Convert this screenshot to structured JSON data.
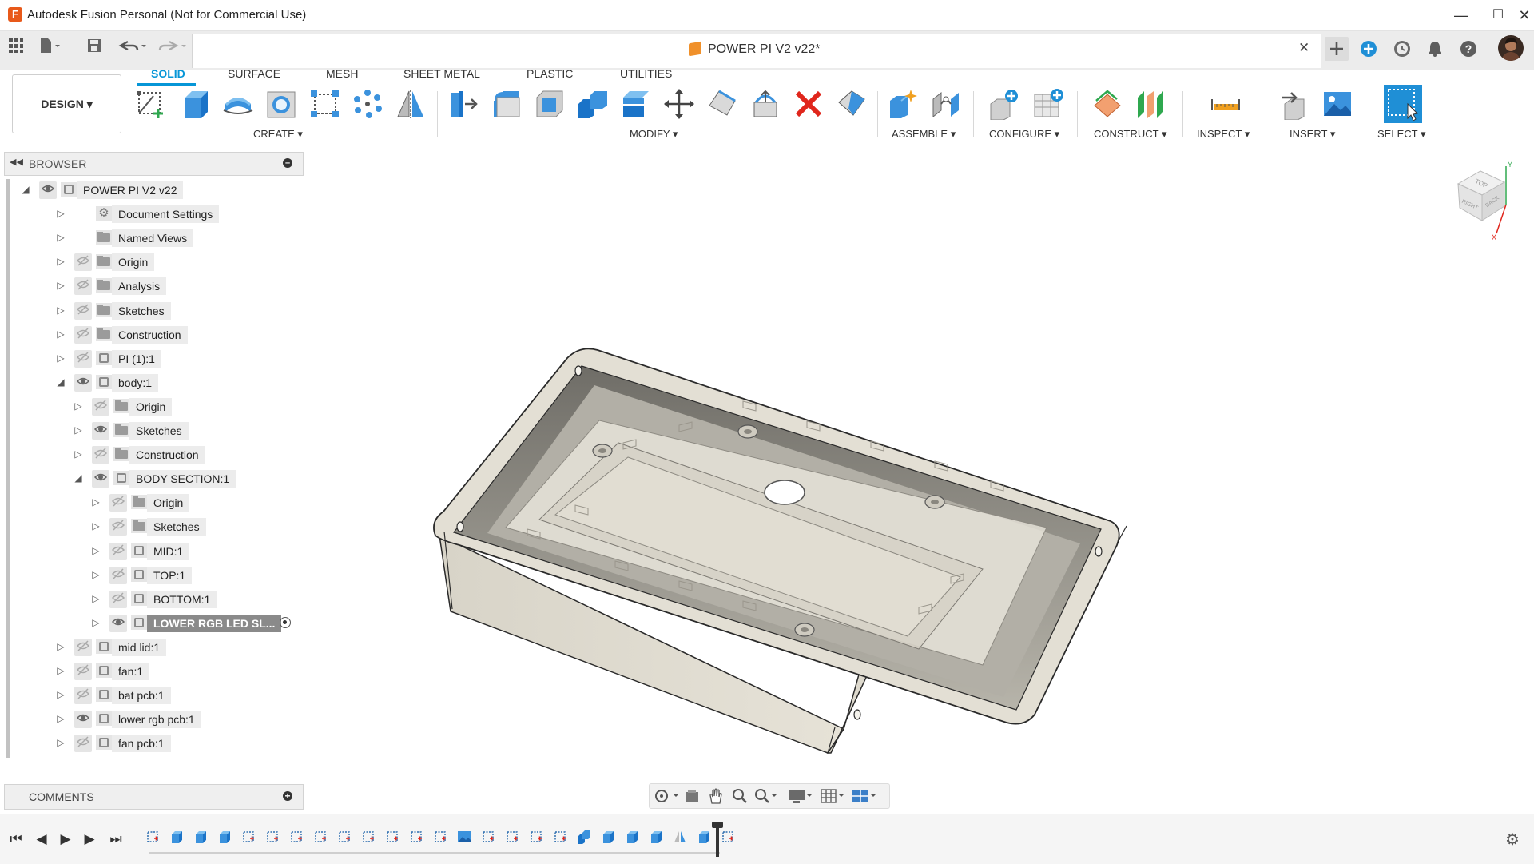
{
  "window": {
    "title": "Autodesk Fusion Personal (Not for Commercial Use)",
    "app_icon_letter": "F",
    "min_glyph": "—",
    "max_glyph": "☐",
    "close_glyph": "✕"
  },
  "document": {
    "tab_title": "POWER PI V2 v22*",
    "close_glyph": "✕"
  },
  "workspace": {
    "label": "DESIGN ▾"
  },
  "ribbon": {
    "tabs": [
      "SOLID",
      "SURFACE",
      "MESH",
      "SHEET METAL",
      "PLASTIC",
      "UTILITIES"
    ],
    "active_tab": "SOLID",
    "groups": [
      "CREATE ▾",
      "MODIFY ▾",
      "ASSEMBLE ▾",
      "CONFIGURE ▾",
      "CONSTRUCT ▾",
      "INSPECT ▾",
      "INSERT ▾",
      "SELECT ▾"
    ]
  },
  "browser": {
    "title": "BROWSER",
    "collapse_glyph": "◀◀",
    "minus_glyph": "–",
    "items": [
      {
        "label": "POWER PI V2 v22",
        "level": 0,
        "expander": "◢",
        "eye": "visible",
        "icon": "comp"
      },
      {
        "label": "Document Settings",
        "level": 1,
        "expander": "▷",
        "eye": "none",
        "icon": "gear"
      },
      {
        "label": "Named Views",
        "level": 1,
        "expander": "▷",
        "eye": "none",
        "icon": "folder"
      },
      {
        "label": "Origin",
        "level": 1,
        "expander": "▷",
        "eye": "hidden",
        "icon": "folder"
      },
      {
        "label": "Analysis",
        "level": 1,
        "expander": "▷",
        "eye": "hidden",
        "icon": "folder"
      },
      {
        "label": "Sketches",
        "level": 1,
        "expander": "▷",
        "eye": "hidden",
        "icon": "folder"
      },
      {
        "label": "Construction",
        "level": 1,
        "expander": "▷",
        "eye": "hidden",
        "icon": "folder"
      },
      {
        "label": "PI (1):1",
        "level": 1,
        "expander": "▷",
        "eye": "hidden",
        "icon": "comp"
      },
      {
        "label": "body:1",
        "level": 1,
        "expander": "◢",
        "eye": "visible",
        "icon": "comp"
      },
      {
        "label": "Origin",
        "level": 2,
        "expander": "▷",
        "eye": "hidden",
        "icon": "folder"
      },
      {
        "label": "Sketches",
        "level": 2,
        "expander": "▷",
        "eye": "visible",
        "icon": "folder"
      },
      {
        "label": "Construction",
        "level": 2,
        "expander": "▷",
        "eye": "hidden",
        "icon": "folder"
      },
      {
        "label": "BODY SECTION:1",
        "level": 2,
        "expander": "◢",
        "eye": "visible",
        "icon": "comp"
      },
      {
        "label": "Origin",
        "level": 3,
        "expander": "▷",
        "eye": "hidden",
        "icon": "folder"
      },
      {
        "label": "Sketches",
        "level": 3,
        "expander": "▷",
        "eye": "hidden",
        "icon": "folder"
      },
      {
        "label": "MID:1",
        "level": 3,
        "expander": "▷",
        "eye": "hidden",
        "icon": "comp"
      },
      {
        "label": "TOP:1",
        "level": 3,
        "expander": "▷",
        "eye": "hidden",
        "icon": "comp"
      },
      {
        "label": "BOTTOM:1",
        "level": 3,
        "expander": "▷",
        "eye": "hidden",
        "icon": "comp"
      },
      {
        "label": "LOWER RGB LED SL...",
        "level": 3,
        "expander": "▷",
        "eye": "visible",
        "icon": "comp",
        "selected": true,
        "active": true
      },
      {
        "label": "mid lid:1",
        "level": 1,
        "expander": "▷",
        "eye": "hidden",
        "icon": "comp"
      },
      {
        "label": "fan:1",
        "level": 1,
        "expander": "▷",
        "eye": "hidden",
        "icon": "comp"
      },
      {
        "label": "bat pcb:1",
        "level": 1,
        "expander": "▷",
        "eye": "hidden",
        "icon": "comp"
      },
      {
        "label": "lower rgb pcb:1",
        "level": 1,
        "expander": "▷",
        "eye": "visible",
        "icon": "comp"
      },
      {
        "label": "fan pcb:1",
        "level": 1,
        "expander": "▷",
        "eye": "hidden",
        "icon": "comp"
      }
    ]
  },
  "comments": {
    "title": "COMMENTS",
    "plus_glyph": "+"
  },
  "viewcube": {
    "top": "TOP",
    "right": "RIGHT",
    "back": "BACK",
    "axis_y": "Y",
    "axis_x": "X"
  },
  "timeline": {
    "buttons": [
      "⏮",
      "◀",
      "▶",
      "▶",
      "⏭"
    ],
    "gear_glyph": "⚙",
    "feature_kinds": [
      "sketch",
      "extrude",
      "extrude",
      "extrude",
      "sketch",
      "sketch",
      "sketch",
      "sketch",
      "sketch",
      "sketch",
      "sketch",
      "sketch",
      "sketch",
      "canvas",
      "sketch",
      "sketch",
      "sketch",
      "sketch",
      "combine",
      "extrude",
      "extrude",
      "extrude",
      "mirror",
      "extrude",
      "sketch"
    ]
  },
  "colors": {
    "accent": "#0696d7",
    "model_surface": "#dcd8cc",
    "model_edge": "#2a2a2a",
    "viewport_bg": "#ffffff"
  }
}
